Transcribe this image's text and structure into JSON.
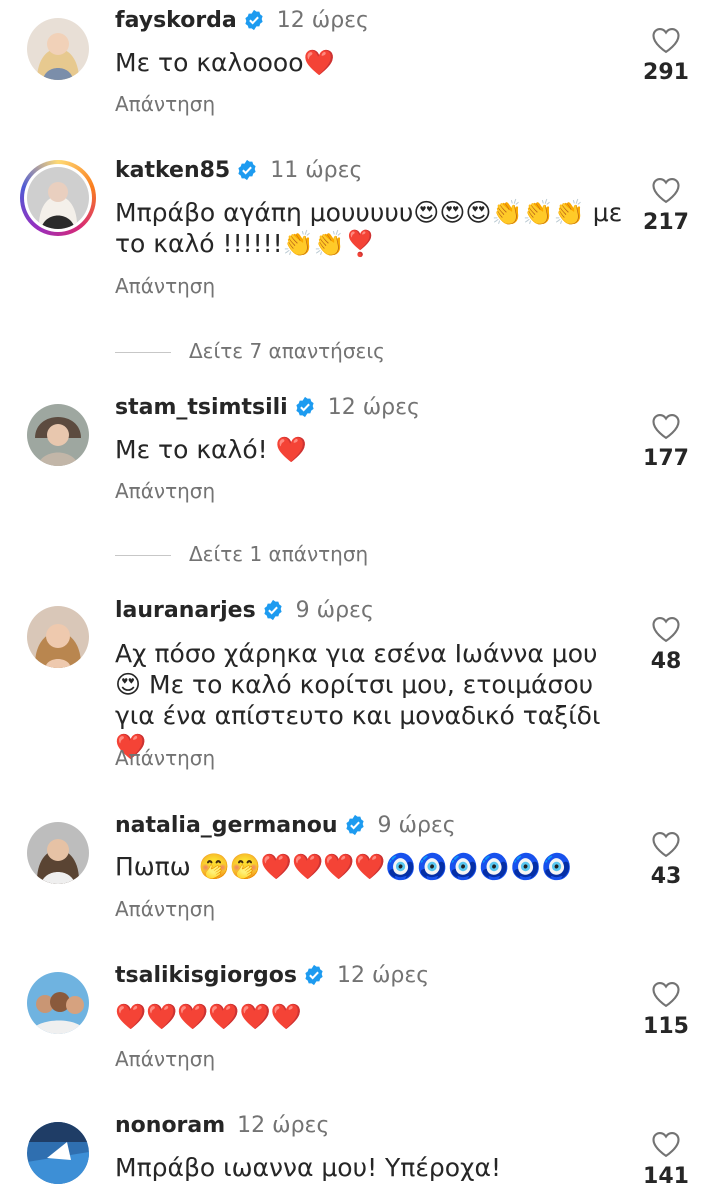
{
  "reply_label": "Απάντηση",
  "colors": {
    "verified": "#1d9bf0",
    "heart": "#ed2a3a",
    "secondary_text": "#737373"
  },
  "comments": [
    {
      "username": "fayskorda",
      "verified": true,
      "time": "12 ώρες",
      "text": "Με το καλοοοο❤️",
      "likes": "291"
    },
    {
      "username": "katken85",
      "verified": true,
      "time": "11 ώρες",
      "text": "Μπράβο αγάπη μουυυυυ😍😍😍👏👏👏 με το καλό !!!!!!👏👏❣️",
      "likes": "217"
    },
    {
      "username": "stam_tsimtsili",
      "verified": true,
      "time": "12 ώρες",
      "text": "Με το καλό! ❤️",
      "likes": "177"
    },
    {
      "username": "lauranarjes",
      "verified": true,
      "time": "9 ώρες",
      "text": "Αχ πόσο χάρηκα για εσένα Ιωάννα μου 😍 Με το καλό κορίτσι μου, ετοιμάσου για ένα απίστευτο και μοναδικό ταξίδι ❤️",
      "likes": "48"
    },
    {
      "username": "natalia_germanou",
      "verified": true,
      "time": "9 ώρες",
      "text": "Πωπω 🤭🤭❤️❤️❤️❤️🧿🧿🧿🧿🧿🧿",
      "likes": "43"
    },
    {
      "username": "tsalikisgiorgos",
      "verified": true,
      "time": "12 ώρες",
      "text": "❤️❤️❤️❤️❤️❤️",
      "likes": "115"
    },
    {
      "username": "nonoram",
      "verified": false,
      "time": "12 ώρες",
      "text": "Μπράβο ιωαννα μου! Υπέροχα!",
      "likes": "141"
    }
  ],
  "view_replies": [
    {
      "label": "Δείτε 7 απαντήσεις"
    },
    {
      "label": "Δείτε 1 απάντηση"
    }
  ]
}
